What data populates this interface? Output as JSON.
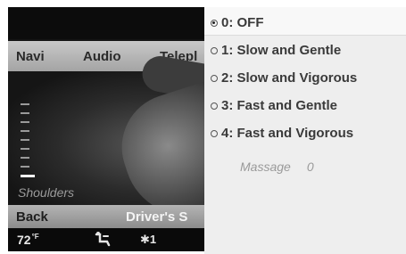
{
  "menu_bar": {
    "items": [
      "Navi",
      "Audio",
      "Telepl"
    ]
  },
  "seat_panel": {
    "scale_label": "Shoulders"
  },
  "back_bar": {
    "back_label": "Back",
    "title": "Driver's S"
  },
  "status_bar": {
    "temperature": "72",
    "temperature_unit": "°F",
    "fan_level": "1"
  },
  "massage_menu": {
    "options": [
      {
        "label": "0: OFF",
        "selected": true
      },
      {
        "label": "1: Slow and Gentle",
        "selected": false
      },
      {
        "label": "2: Slow and Vigorous",
        "selected": false
      },
      {
        "label": "3: Fast and Gentle",
        "selected": false
      },
      {
        "label": "4: Fast and Vigorous",
        "selected": false
      }
    ],
    "massage_label": "Massage",
    "massage_value": "0"
  },
  "icons": {
    "airflow": "airflow-icon",
    "fan": "fan-icon"
  }
}
